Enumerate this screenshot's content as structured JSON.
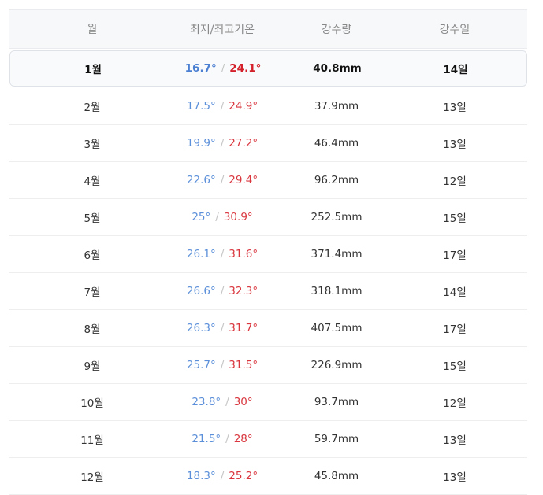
{
  "header": {
    "month": "월",
    "temp": "최저/최고기온",
    "precip": "강수량",
    "days": "강수일"
  },
  "rows": [
    {
      "month": "1월",
      "min": "16.7°",
      "max": "24.1°",
      "precip": "40.8mm",
      "days": "14일"
    },
    {
      "month": "2월",
      "min": "17.5°",
      "max": "24.9°",
      "precip": "37.9mm",
      "days": "13일"
    },
    {
      "month": "3월",
      "min": "19.9°",
      "max": "27.2°",
      "precip": "46.4mm",
      "days": "13일"
    },
    {
      "month": "4월",
      "min": "22.6°",
      "max": "29.4°",
      "precip": "96.2mm",
      "days": "12일"
    },
    {
      "month": "5월",
      "min": "25°",
      "max": "30.9°",
      "precip": "252.5mm",
      "days": "15일"
    },
    {
      "month": "6월",
      "min": "26.1°",
      "max": "31.6°",
      "precip": "371.4mm",
      "days": "17일"
    },
    {
      "month": "7월",
      "min": "26.6°",
      "max": "32.3°",
      "precip": "318.1mm",
      "days": "14일"
    },
    {
      "month": "8월",
      "min": "26.3°",
      "max": "31.7°",
      "precip": "407.5mm",
      "days": "17일"
    },
    {
      "month": "9월",
      "min": "25.7°",
      "max": "31.5°",
      "precip": "226.9mm",
      "days": "15일"
    },
    {
      "month": "10월",
      "min": "23.8°",
      "max": "30°",
      "precip": "93.7mm",
      "days": "12일"
    },
    {
      "month": "11월",
      "min": "21.5°",
      "max": "28°",
      "precip": "59.7mm",
      "days": "13일"
    },
    {
      "month": "12월",
      "min": "18.3°",
      "max": "25.2°",
      "precip": "45.8mm",
      "days": "13일"
    }
  ],
  "separator": "/",
  "colors": {
    "min_temp": "#5b8fd9",
    "max_temp": "#d9363e"
  }
}
